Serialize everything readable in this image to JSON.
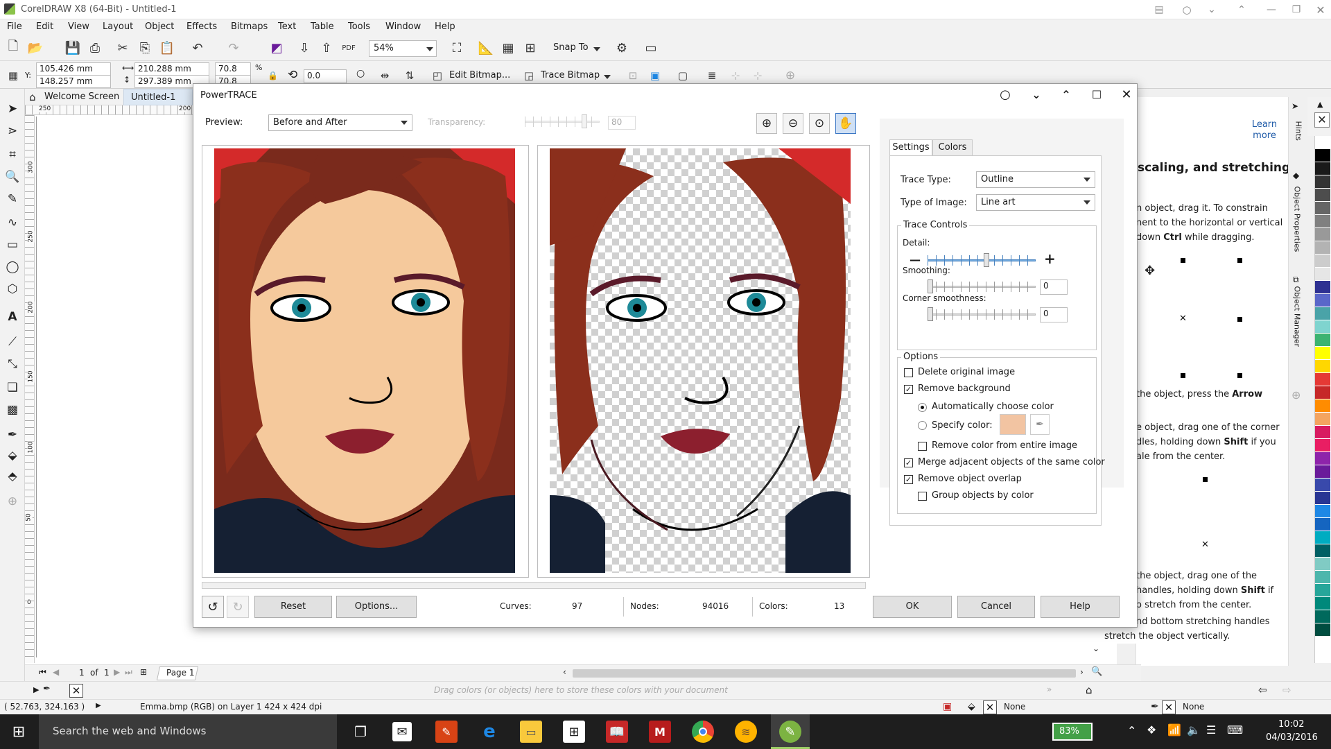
{
  "app": {
    "title": "CorelDRAW X8 (64-Bit) - Untitled-1"
  },
  "menu": [
    "File",
    "Edit",
    "View",
    "Layout",
    "Object",
    "Effects",
    "Bitmaps",
    "Text",
    "Table",
    "Tools",
    "Window",
    "Help"
  ],
  "toolbar": {
    "zoom": "54%",
    "snap_to": "Snap To"
  },
  "propbar": {
    "x": "105.426 mm",
    "y": "148.257 mm",
    "x_label": "X:",
    "y_label": "Y:",
    "width": "210.288 mm",
    "height": "297.389 mm",
    "scale_w": "70.8",
    "scale_h": "70.8",
    "percent": "%",
    "rotation": "0.0",
    "edit_bitmap": "Edit Bitmap...",
    "trace_bitmap": "Trace Bitmap"
  },
  "tabs": {
    "welcome": "Welcome Screen",
    "doc": "Untitled-1"
  },
  "ruler": {
    "top": [
      "250",
      "200"
    ],
    "left": [
      "300",
      "250",
      "200",
      "150",
      "100",
      "50",
      "0"
    ]
  },
  "dialog": {
    "title": "PowerTRACE",
    "preview_label": "Preview:",
    "preview_value": "Before and After",
    "transparency_label": "Transparency:",
    "transparency_value": "80",
    "tabs": [
      "Settings",
      "Colors"
    ],
    "trace_type_label": "Trace Type:",
    "trace_type_value": "Outline",
    "image_type_label": "Type of Image:",
    "image_type_value": "Line art",
    "trace_controls_label": "Trace Controls",
    "detail_label": "Detail:",
    "detail_value": 0.55,
    "smoothing_label": "Smoothing:",
    "smoothing_value": "0",
    "corner_label": "Corner smoothness:",
    "corner_value": "0",
    "options_label": "Options",
    "opt_delete": "Delete original image",
    "opt_remove_bg": "Remove background",
    "opt_auto_color": "Automatically choose color",
    "opt_specify_color": "Specify color:",
    "opt_remove_color": "Remove color from entire image",
    "opt_merge": "Merge adjacent objects of the same color",
    "opt_overlap": "Remove object overlap",
    "opt_group": "Group objects by color",
    "specify_swatch": "#f2c4a2",
    "reset": "Reset",
    "options_btn": "Options...",
    "curves_label": "Curves:",
    "curves_value": "97",
    "nodes_label": "Nodes:",
    "nodes_value": "94016",
    "colors_label": "Colors:",
    "colors_value": "13",
    "ok": "OK",
    "cancel": "Cancel",
    "help": "Help"
  },
  "hints": {
    "learn_more": "Learn more",
    "heading": "scaling, and stretching",
    "p1": "n object, drag it. To constrain",
    "p1b": "nent to the horizontal or vertical",
    "p1c_a": "down ",
    "p1c_b": "Ctrl",
    "p1c_c": " while dragging.",
    "p2_a": "the object, press the ",
    "p2_b": "Arrow",
    "p3a": "e object, drag one of the corner",
    "p3b_a": "dles, holding down ",
    "p3b_b": "Shift",
    "p3b_c": " if you",
    "p3c": "ale from the center.",
    "p4a": "the object, drag one of the",
    "p4b_a": "handles, holding down ",
    "p4b_b": "Shift",
    "p4b_c": " if",
    "p4c": "o stretch from the center.",
    "p5a": "nd bottom stretching handles",
    "p5b": "stretch the object vertically."
  },
  "vtabs": [
    "Hints",
    "Object Properties",
    "Object Manager"
  ],
  "palette": [
    "#ffffff",
    "#000000",
    "#1a1a1a",
    "#333333",
    "#4d4d4d",
    "#666666",
    "#808080",
    "#999999",
    "#b3b3b3",
    "#cccccc",
    "#e6e6e6",
    "#2e3192",
    "#5a67c9",
    "#4aa3a8",
    "#7fd4cf",
    "#3cb371",
    "#ffff00",
    "#ffd700",
    "#e53935",
    "#c62828",
    "#ff8c00",
    "#f4a460",
    "#d81b60",
    "#e91e63",
    "#8e24aa",
    "#6a1b9a",
    "#3949ab",
    "#283593",
    "#1e88e5",
    "#1565c0",
    "#00acc1",
    "#006064",
    "#80cbc4",
    "#4db6ac",
    "#26a69a",
    "#00897b",
    "#00695c",
    "#004d40"
  ],
  "status": {
    "page_count": "1",
    "of": "of",
    "page_total": "1",
    "page_tab": "Page 1",
    "drag_hint": "Drag colors (or objects) here to store these colors with your document",
    "coords": "( 52.763, 324.163 )",
    "object_info": "Emma.bmp (RGB) on Layer 1 424 x 424 dpi",
    "fill_none": "None",
    "outline_none": "None"
  },
  "taskbar": {
    "search": "Search the web and Windows",
    "battery": "83%",
    "time": "10:02",
    "date": "04/03/2016"
  }
}
